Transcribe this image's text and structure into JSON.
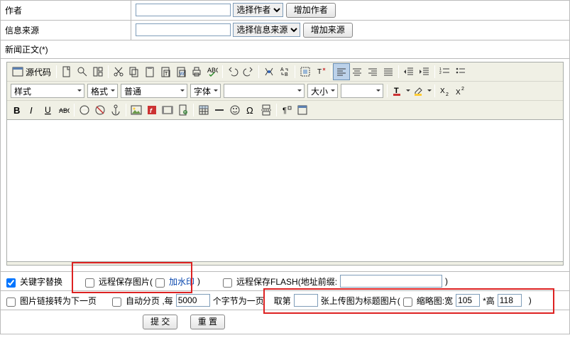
{
  "rows": {
    "author_label": "作者",
    "author_select": "选择作者",
    "add_author_btn": "增加作者",
    "source_label": "信息来源",
    "source_select": "选择信息来源",
    "add_source_btn": "增加来源"
  },
  "section": {
    "body_title": "新闻正文(*)"
  },
  "editor": {
    "source_btn": "源代码",
    "combo_style": "样式",
    "combo_format": "格式",
    "combo_format_value": "普通",
    "combo_font": "字体",
    "combo_size": "大小"
  },
  "opts": {
    "keyword_replace": "关键字替换",
    "remote_save_img": "远程保存图片(",
    "watermark": "加水印",
    "close_paren": ")",
    "remote_save_flash": "远程保存FLASH(地址前缀:",
    "img_link_next": "图片链接转为下一页",
    "auto_page": "自动分页 ,每",
    "auto_page_value": "5000",
    "auto_page_suffix": "个字节为一页",
    "take_nth_prefix": "取第",
    "take_nth_suffix": "张上传图为标题图片(",
    "thumb_label": "缩略图:宽",
    "thumb_w": "105",
    "thumb_mid": "*高",
    "thumb_h": "118"
  },
  "buttons": {
    "submit": "提 交",
    "reset": "重 置"
  }
}
